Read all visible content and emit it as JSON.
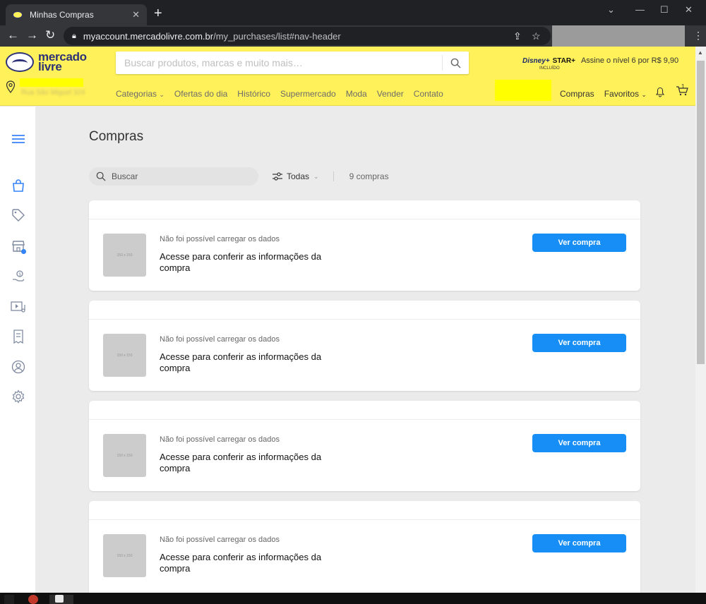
{
  "browser": {
    "tab_title": "Minhas Compras",
    "tab_close": "✕",
    "new_tab": "+",
    "url_host": "myaccount.mercadolivre.com.br",
    "url_path": "/my_purchases/list#nav-header",
    "win_min": "—",
    "win_max": "☐",
    "win_close": "✕"
  },
  "header": {
    "logo_line1": "mercado",
    "logo_line2": "livre",
    "search_placeholder": "Buscar produtos, marcas e muito mais…",
    "promo_disney": "Disney+",
    "promo_star": "STAR+",
    "promo_included": "INCLUÍDO",
    "promo_text": "Assine o nível 6 por R$ 9,90",
    "address": "Rua São Miguel 324",
    "nav": [
      "Categorias",
      "Ofertas do dia",
      "Histórico",
      "Supermercado",
      "Moda",
      "Vender",
      "Contato"
    ],
    "right_nav": [
      "Compras",
      "Favoritos"
    ],
    "cart_count": "1"
  },
  "main": {
    "title": "Compras",
    "search_placeholder": "Buscar",
    "filter_label": "Todas",
    "count_label": "9 compras"
  },
  "purchases": [
    {
      "thumb": "150 x 150",
      "status": "Não foi possível carregar os dados",
      "description": "Acesse para conferir as informações da compra",
      "button": "Ver compra"
    },
    {
      "thumb": "150 x 150",
      "status": "Não foi possível carregar os dados",
      "description": "Acesse para conferir as informações da compra",
      "button": "Ver compra"
    },
    {
      "thumb": "150 x 150",
      "status": "Não foi possível carregar os dados",
      "description": "Acesse para conferir as informações da compra",
      "button": "Ver compra"
    },
    {
      "thumb": "150 x 150",
      "status": "Não foi possível carregar os dados",
      "description": "Acesse para conferir as informações da compra",
      "button": "Ver compra"
    }
  ],
  "colors": {
    "brand_yellow": "#fff159",
    "accent_blue": "#3483fa",
    "button_blue": "#168ef5"
  },
  "sidebar_icons": [
    "menu-icon",
    "shopping-bag-icon",
    "tag-icon",
    "store-icon",
    "money-hand-icon",
    "media-icon",
    "receipt-icon",
    "user-icon",
    "gear-icon"
  ]
}
